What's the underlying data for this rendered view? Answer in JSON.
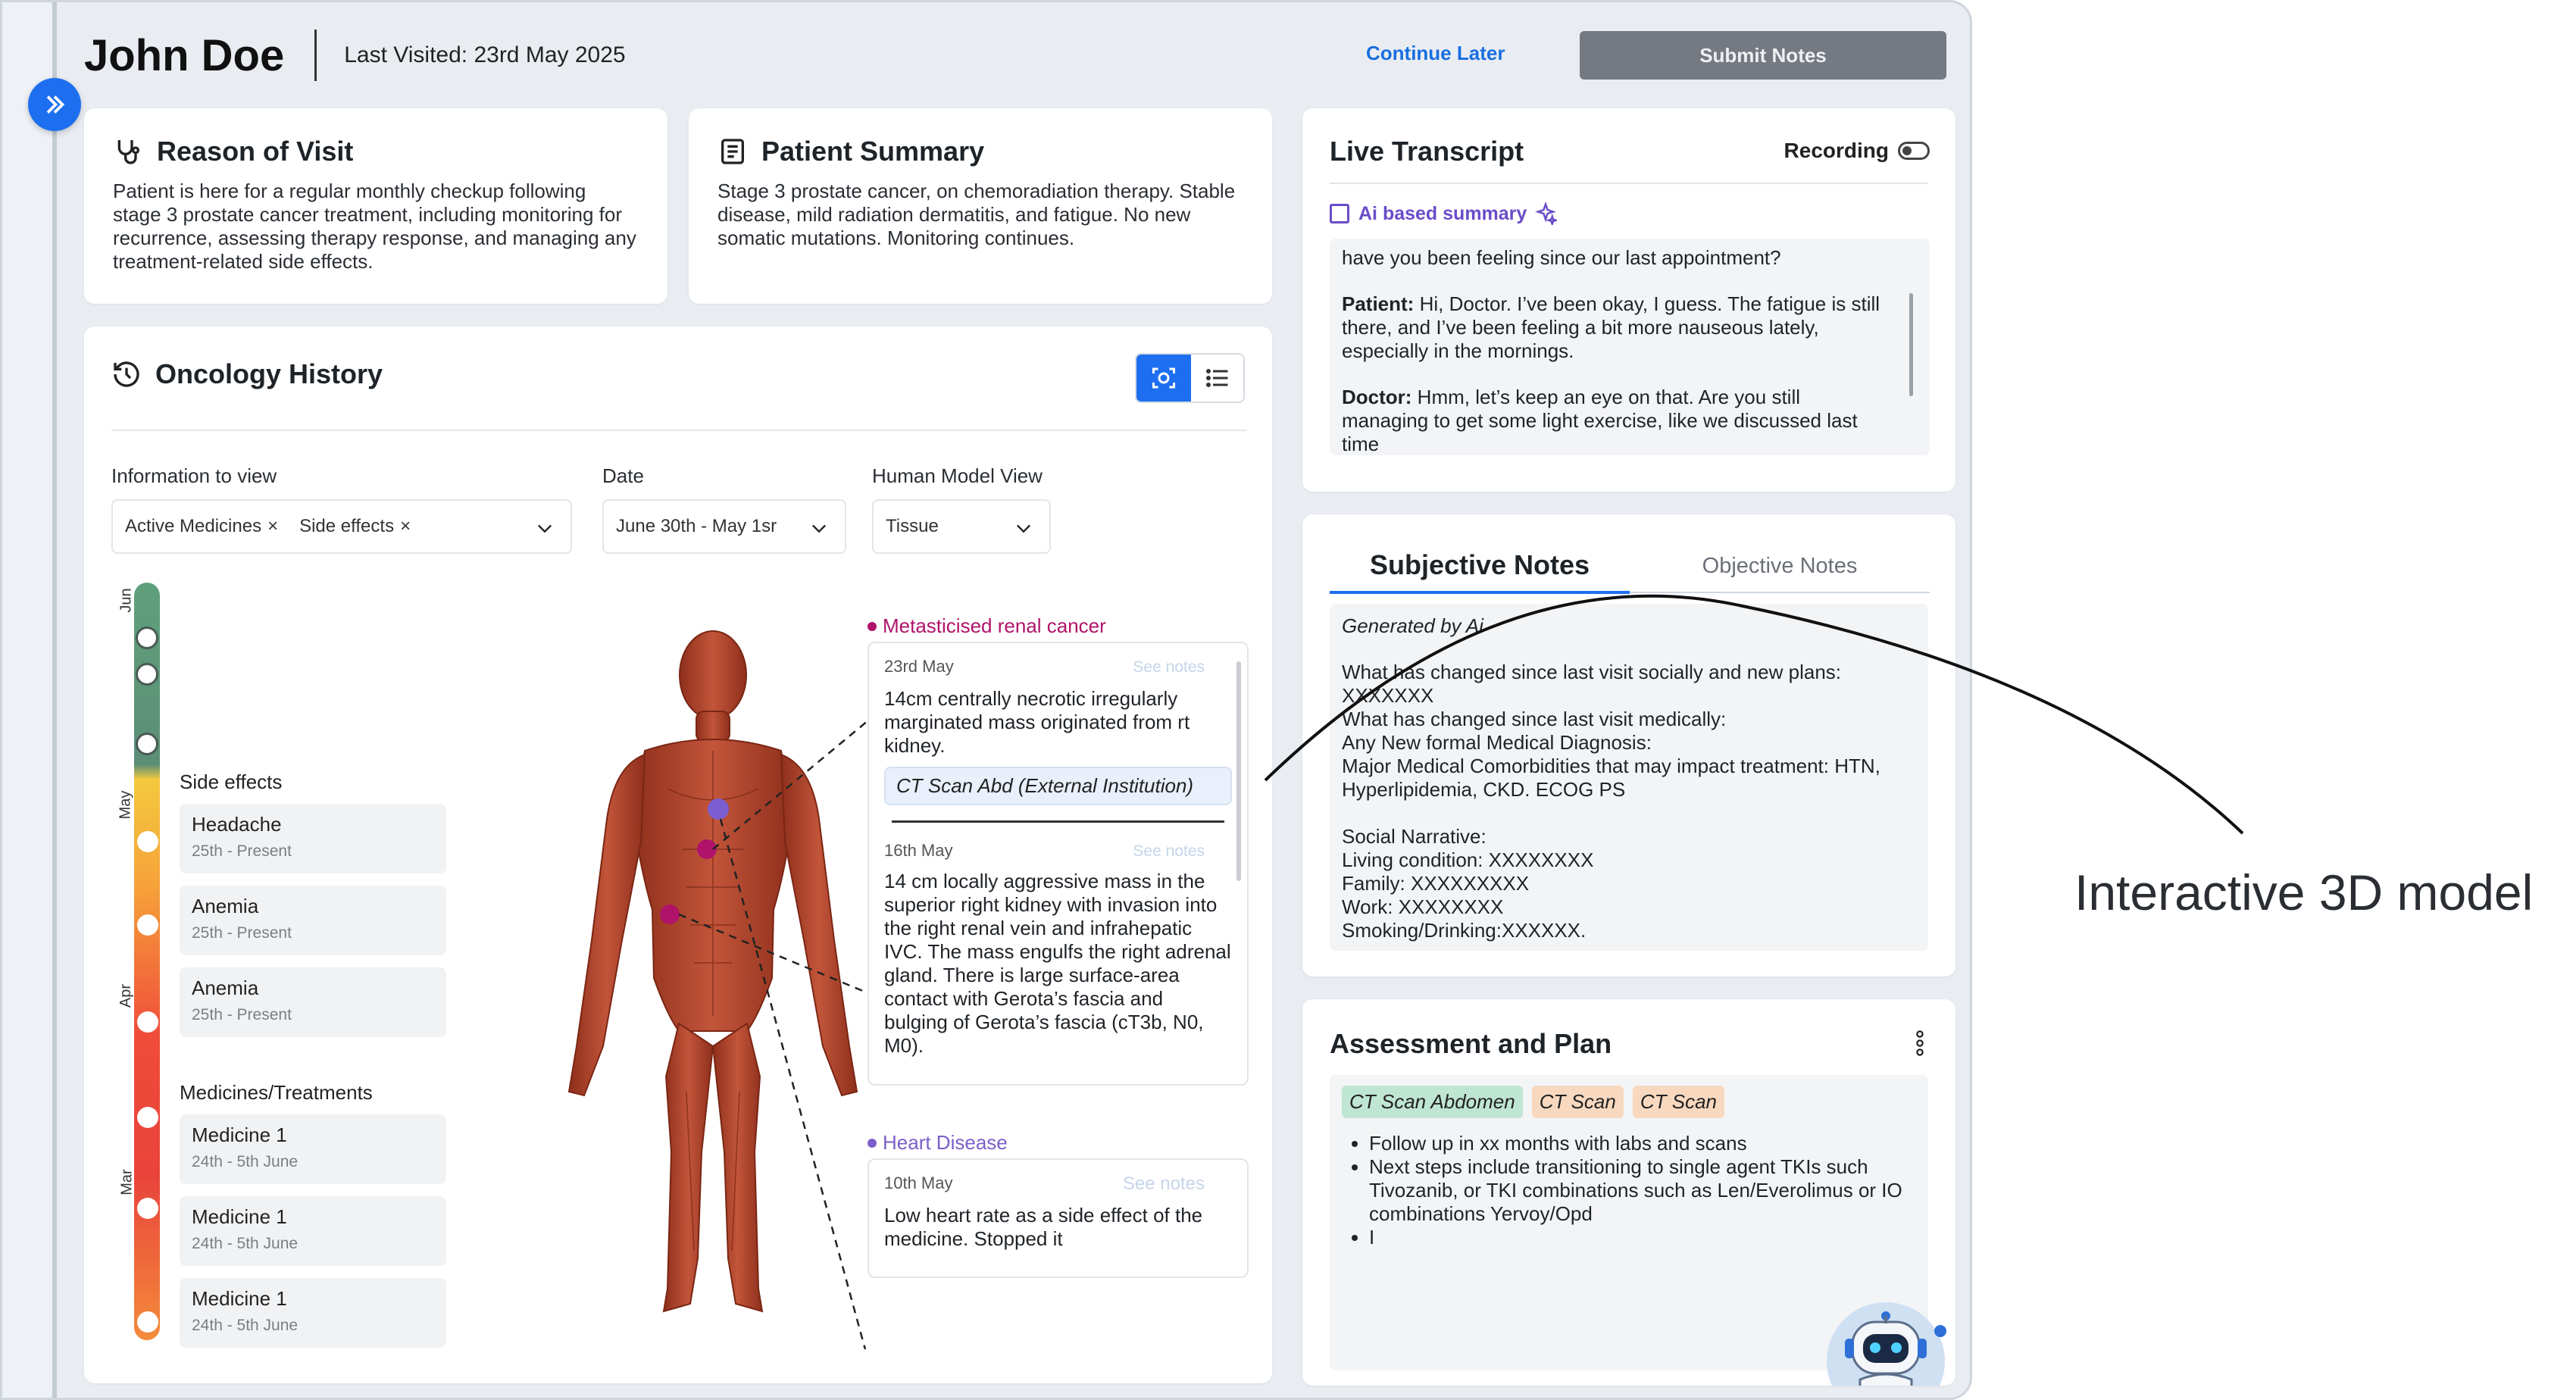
{
  "header": {
    "patient_name": "John Doe",
    "last_visited": "Last Visited: 23rd May 2025",
    "continue_later": "Continue Later",
    "submit_notes": "Submit Notes"
  },
  "reason": {
    "title": "Reason of Visit",
    "text": "Patient is here for a regular monthly checkup following stage 3 prostate cancer treatment, including monitoring for recurrence, assessing therapy response, and managing any treatment-related side effects."
  },
  "summary": {
    "title": "Patient Summary",
    "text": "Stage 3 prostate cancer, on chemoradiation therapy. Stable disease, mild radiation dermatitis, and fatigue. No new somatic mutations. Monitoring continues."
  },
  "oncology": {
    "title": "Oncology History",
    "filters": {
      "info_label": "Information to view",
      "info_tags": [
        "Active Medicines",
        "Side effects"
      ],
      "date_label": "Date",
      "date_value": "June 30th - May 1sr",
      "model_label": "Human Model View",
      "model_value": "Tissue"
    },
    "timeline_months": [
      "Jun",
      "May",
      "Apr",
      "Mar"
    ],
    "side_effects_label": "Side effects",
    "side_effects": [
      {
        "name": "Headache",
        "dates": "25th - Present"
      },
      {
        "name": "Anemia",
        "dates": "25th - Present"
      },
      {
        "name": "Anemia",
        "dates": "25th - Present"
      }
    ],
    "medicines_label": "Medicines/Treatments",
    "medicines": [
      {
        "name": "Medicine 1",
        "dates": "24th - 5th June"
      },
      {
        "name": "Medicine 1",
        "dates": "24th - 5th June"
      },
      {
        "name": "Medicine 1",
        "dates": "24th - 5th June"
      }
    ],
    "condition1": {
      "name": "Metasticised renal cancer",
      "color": "#b0136a",
      "notes": [
        {
          "date": "23rd May",
          "see": "See notes",
          "text": "14cm centrally necrotic irregularly marginated mass originated from rt kidney.",
          "source": "CT Scan Abd (External Institution)"
        },
        {
          "date": "16th May",
          "see": "See notes",
          "text": "14 cm locally aggressive mass in the superior right kidney with invasion into the right renal vein and infrahepatic IVC. The mass engulfs the right adrenal gland. There is large surface-area contact with Gerota’s fascia and bulging of Gerota’s fascia (cT3b, N0, M0)."
        }
      ]
    },
    "condition2": {
      "name": "Heart Disease",
      "color": "#7a5fc9",
      "notes": [
        {
          "date": "10th May",
          "see": "See notes",
          "text": "Low heart rate as a side effect of the medicine. Stopped it"
        }
      ]
    }
  },
  "transcript": {
    "title": "Live Transcript",
    "recording": "Recording",
    "ai_summary": "Ai based summary",
    "q0": "have you been feeling since our last appointment?",
    "p_label": "Patient:",
    "p_text": "Hi, Doctor. I’ve been okay, I guess. The fatigue is still there, and I’ve been feeling a bit more nauseous lately, especially in the mornings.",
    "d_label": "Doctor:",
    "d_text": "Hmm, let’s keep an eye on that. Are you still managing to get some light exercise, like we discussed last time"
  },
  "notes": {
    "tab_subjective": "Subjective Notes",
    "tab_objective": "Objective Notes",
    "generated": "Generated by Ai",
    "lines": [
      "What has changed since last visit socially and new plans:",
      "XXXXXXX",
      "What has changed since last visit medically:",
      "Any New formal Medical Diagnosis:",
      "Major Medical Comorbidities that may impact treatment: HTN, Hyperlipidemia, CKD. ECOG PS",
      "",
      "Social Narrative:",
      "Living condition: XXXXXXXX",
      "Family: XXXXXXXXX",
      "Work: XXXXXXXX",
      "Smoking/Drinking:XXXXXX."
    ]
  },
  "plan": {
    "title": "Assessment and Plan",
    "tags": [
      "CT Scan Abdomen",
      "CT Scan",
      "CT Scan"
    ],
    "bullets": [
      "Follow up in xx months with labs and scans",
      "Next steps include transitioning to single agent TKIs such Tivozanib, or TKI combinations such as Len/Everolimus or IO combinations Yervoy/Opd",
      "I"
    ]
  },
  "annotation": "Interactive 3D model"
}
